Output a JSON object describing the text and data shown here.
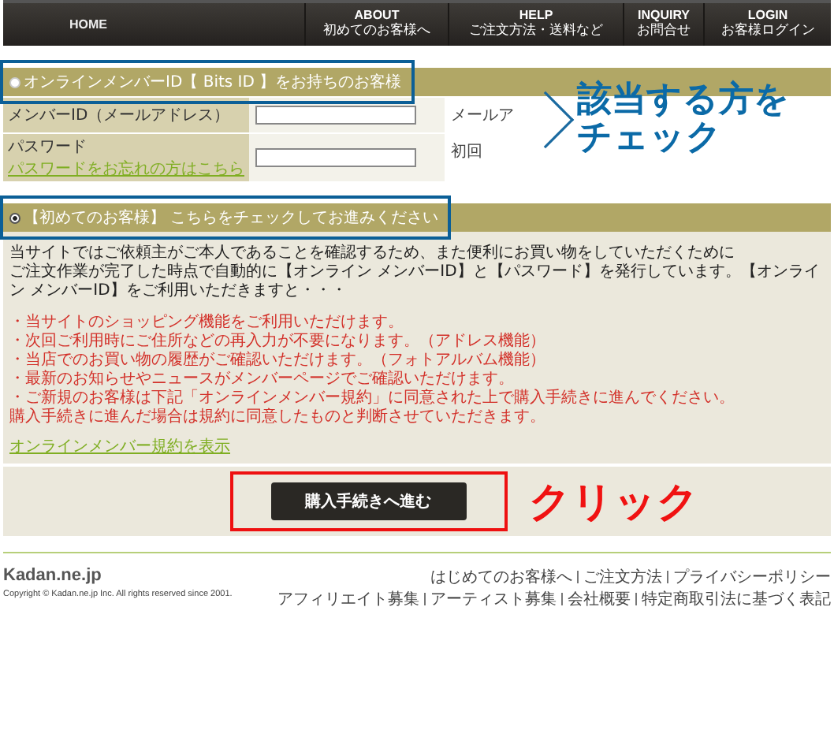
{
  "header": {
    "home": "HOME",
    "nav": [
      {
        "label": "ABOUT",
        "sub": "初めてのお客様へ"
      },
      {
        "label": "HELP",
        "sub": "ご注文方法・送料など"
      },
      {
        "label": "INQUIRY",
        "sub": "お問合せ"
      },
      {
        "label": "LOGIN",
        "sub": "お客様ログイン"
      }
    ]
  },
  "sections": [
    {
      "label": "オンラインメンバーID【 Bits ID 】をお持ちのお客様",
      "selected": false,
      "highlighted": true,
      "fields": [
        {
          "label": "メンバーID（メールアドレス）",
          "note": "メールア"
        },
        {
          "label": "パスワード",
          "link": "パスワードをお忘れの方はこちら",
          "note": "初回"
        }
      ]
    },
    {
      "label": "【初めてのお客様】 こちらをチェックしてお進みください",
      "selected": true,
      "highlighted": true,
      "intro": [
        "当サイトではご依頼主がご本人であることを確認するため、また便利にお買い物をしていただくために",
        "ご注文作業が完了した時点で自動的に【オンライン メンバーID】と【パスワード】を発行しています。【オンライン メンバーID】をご利用いただきますと・・・"
      ],
      "benefits": [
        "・当サイトのショッピング機能をご利用いただけます。",
        "・次回ご利用時にご住所などの再入力が不要になります。（アドレス機能）",
        "・当店でのお買い物の履歴がご確認いただけます。（フォトアルバム機能）",
        "・最新のお知らせやニュースがメンバーページでご確認いただけます。",
        "・ご新規のお客様は下記「オンラインメンバー規約」に同意された上で購入手続きに進んでください。",
        "購入手続きに進んだ場合は規約に同意したものと判断させていただきます。"
      ],
      "terms_link": "オンラインメンバー規約を表示"
    }
  ],
  "callout": [
    "該当する方を",
    "チェック"
  ],
  "submit": {
    "label": "購入手続きへ進む",
    "callout": "クリック"
  },
  "footer": {
    "logo": "Kadan.ne.jp",
    "copyright": "Copyright © Kadan.ne.jp Inc. All rights reserved since 2001.",
    "link_rows": [
      [
        "はじめてのお客様へ",
        "ご注文方法",
        "プライバシーポリシー"
      ],
      [
        "アフィリエイト募集",
        "アーティスト募集",
        "会社概要",
        "特定商取引法に基づく表記"
      ]
    ]
  }
}
